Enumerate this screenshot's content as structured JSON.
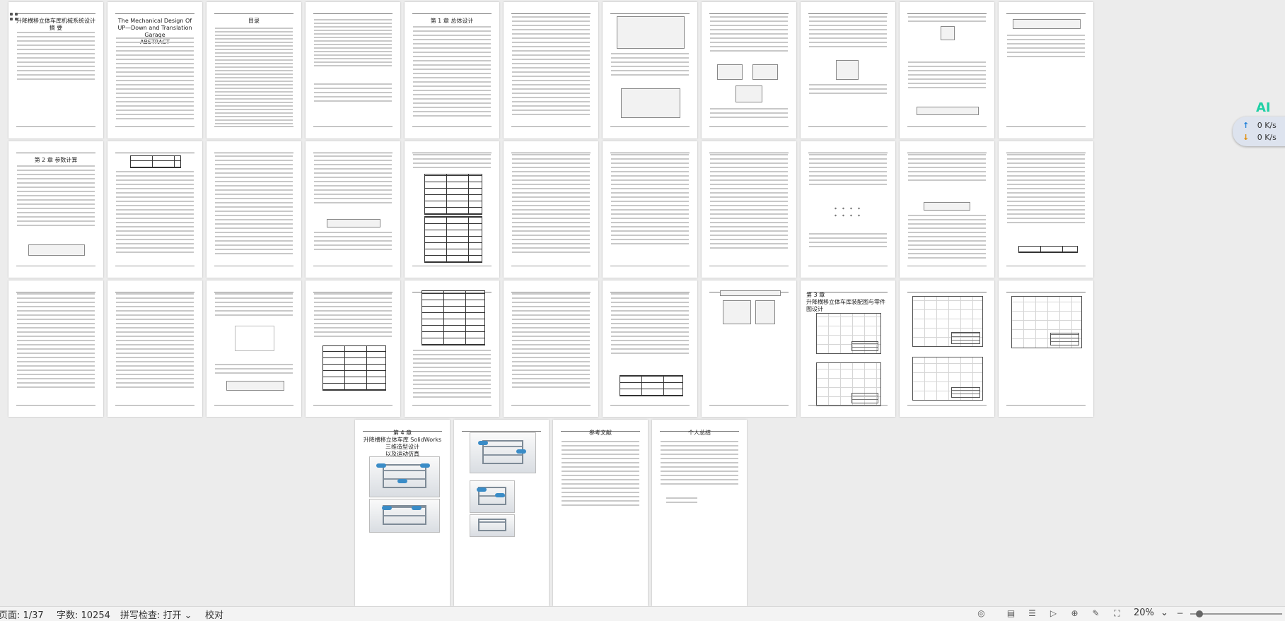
{
  "statusbar": {
    "page": "页面: 1/37",
    "words": "字数: 10254",
    "spellcheck": "拼写检查: 打开",
    "spellcheck_arrow": "⌄",
    "proofread": "校对",
    "zoom": "20%",
    "zoom_arrow": "⌄"
  },
  "network": {
    "up": "0 K/s",
    "down": "0 K/s",
    "up_arrow": "↑",
    "down_arrow": "↓",
    "ai_label": "AI"
  },
  "pages": {
    "p1_title": "升降横移立体车库机械系统设计\n摘  要",
    "p2_title": "The Mechanical Design Of\nUP—Down and Translation Garage\nABSTRACT",
    "p3_title": "目录",
    "p5_title": "第 1 章 总体设计",
    "p12_title": "第 2 章 参数计算",
    "p30_title": "第 3 章\n升降横移立体车库装配图与零件图设计",
    "p32_title": "第 4 章\n升降横移立体车库 SolidWorks 三维造型设计\n以及运动仿真",
    "p34_title": "参考文献",
    "p35_title": "个人总结"
  }
}
